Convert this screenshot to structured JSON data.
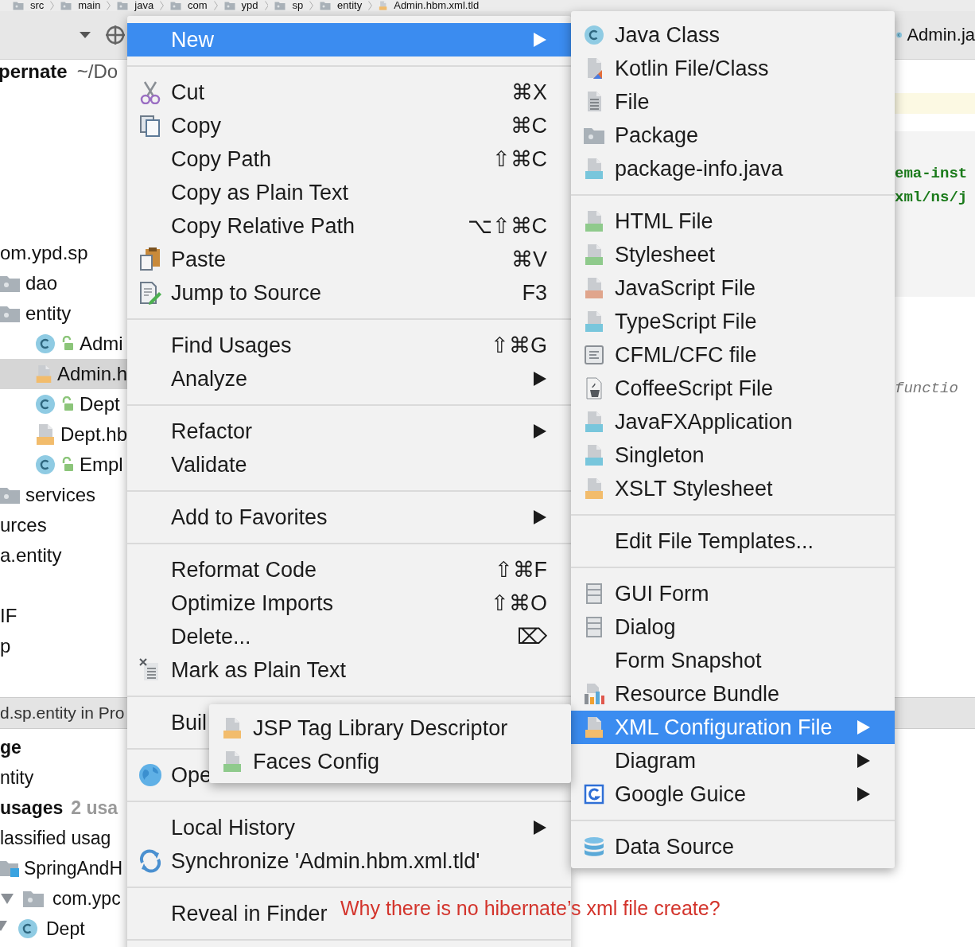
{
  "breadcrumb": [
    "src",
    "main",
    "java",
    "com",
    "ypd",
    "sp",
    "entity",
    "Admin.hbm.xml.tld"
  ],
  "toolbar": {
    "tab": "Admin.ja"
  },
  "project_tree": {
    "root": {
      "name": "pernate",
      "path": "~/Do"
    },
    "items": [
      {
        "label": "om.ypd.sp",
        "selected": false,
        "children": [
          {
            "label": "dao",
            "kind": "package",
            "selected": false
          },
          {
            "label": "entity",
            "kind": "package",
            "selected": false,
            "children": [
              {
                "label": "Admi",
                "kind": "class",
                "selected": false
              },
              {
                "label": "Admin.h",
                "kind": "xml",
                "selected": true
              },
              {
                "label": "Dept",
                "kind": "class",
                "selected": false
              },
              {
                "label": "Dept.hb",
                "kind": "xml",
                "selected": false
              },
              {
                "label": "Empl",
                "kind": "class",
                "selected": false
              }
            ]
          },
          {
            "label": "services",
            "kind": "package",
            "selected": false
          }
        ]
      },
      {
        "label": "urces",
        "selected": false
      },
      {
        "label": "a.entity",
        "selected": false
      },
      {
        "label": "IF",
        "selected": false
      },
      {
        "label": "p",
        "selected": false
      }
    ]
  },
  "usages_panel": {
    "title": "d.sp.entity in Pro",
    "rows": [
      {
        "label": "ge",
        "kind": "heading"
      },
      {
        "label": "ntity",
        "kind": "text"
      },
      {
        "label": "usages",
        "kind": "group",
        "count": "2 usa"
      },
      {
        "label": "lassified usag",
        "kind": "text",
        "children": [
          {
            "label": "SpringAndH",
            "kind": "module",
            "children": [
              {
                "label": "com.ypc",
                "kind": "package",
                "expanded": true,
                "children": [
                  {
                    "label": "Dept",
                    "kind": "class",
                    "expanded": true
                  }
                ]
              }
            ]
          }
        ]
      }
    ]
  },
  "editor": {
    "lines": [
      {
        "kind": "string",
        "text": "ema-inst"
      },
      {
        "kind": "string",
        "text": "xml/ns/j"
      },
      {
        "kind": "comment",
        "text": "functio"
      }
    ]
  },
  "context_menu": {
    "items": [
      {
        "kind": "item",
        "label": "New",
        "submenu": true,
        "selected": true
      },
      {
        "kind": "separator"
      },
      {
        "kind": "item",
        "label": "Cut",
        "shortcut": "⌘X",
        "selected": false
      },
      {
        "kind": "item",
        "label": "Copy",
        "shortcut": "⌘C",
        "selected": false
      },
      {
        "kind": "item",
        "label": "Copy Path",
        "shortcut": "⇧⌘C",
        "selected": false
      },
      {
        "kind": "item",
        "label": "Copy as Plain Text",
        "selected": false
      },
      {
        "kind": "item",
        "label": "Copy Relative Path",
        "shortcut": "⌥⇧⌘C",
        "selected": false
      },
      {
        "kind": "item",
        "label": "Paste",
        "shortcut": "⌘V",
        "selected": false
      },
      {
        "kind": "item",
        "label": "Jump to Source",
        "shortcut": "F3",
        "selected": false
      },
      {
        "kind": "separator"
      },
      {
        "kind": "item",
        "label": "Find Usages",
        "shortcut": "⇧⌘G",
        "selected": false
      },
      {
        "kind": "item",
        "label": "Analyze",
        "submenu": true,
        "selected": false
      },
      {
        "kind": "separator"
      },
      {
        "kind": "item",
        "label": "Refactor",
        "submenu": true,
        "selected": false
      },
      {
        "kind": "item",
        "label": "Validate",
        "selected": false
      },
      {
        "kind": "separator"
      },
      {
        "kind": "item",
        "label": "Add to Favorites",
        "submenu": true,
        "selected": false
      },
      {
        "kind": "separator"
      },
      {
        "kind": "item",
        "label": "Reformat Code",
        "shortcut": "⇧⌘F",
        "selected": false
      },
      {
        "kind": "item",
        "label": "Optimize Imports",
        "shortcut": "⇧⌘O",
        "selected": false
      },
      {
        "kind": "item",
        "label": "Delete...",
        "shortcut": "⌦",
        "selected": false
      },
      {
        "kind": "item",
        "label": "Mark as Plain Text",
        "selected": false
      },
      {
        "kind": "separator"
      },
      {
        "kind": "item",
        "label": "Buil",
        "selected": false
      },
      {
        "kind": "separator"
      },
      {
        "kind": "item",
        "label": "Ope",
        "selected": false
      },
      {
        "kind": "separator"
      },
      {
        "kind": "item",
        "label": "Local History",
        "submenu": true,
        "selected": false
      },
      {
        "kind": "item",
        "label": "Synchronize 'Admin.hbm.xml.tld'",
        "selected": false
      },
      {
        "kind": "separator"
      },
      {
        "kind": "item",
        "label": "Reveal in Finder",
        "selected": false
      },
      {
        "kind": "separator"
      }
    ]
  },
  "new_submenu": {
    "items": [
      {
        "kind": "item",
        "label": "Java Class",
        "selected": false
      },
      {
        "kind": "item",
        "label": "Kotlin File/Class",
        "selected": false
      },
      {
        "kind": "item",
        "label": "File",
        "selected": false
      },
      {
        "kind": "item",
        "label": "Package",
        "selected": false
      },
      {
        "kind": "item",
        "label": "package-info.java",
        "selected": false
      },
      {
        "kind": "separator"
      },
      {
        "kind": "item",
        "label": "HTML File",
        "selected": false
      },
      {
        "kind": "item",
        "label": "Stylesheet",
        "selected": false
      },
      {
        "kind": "item",
        "label": "JavaScript File",
        "selected": false
      },
      {
        "kind": "item",
        "label": "TypeScript File",
        "selected": false
      },
      {
        "kind": "item",
        "label": "CFML/CFC file",
        "selected": false
      },
      {
        "kind": "item",
        "label": "CoffeeScript File",
        "selected": false
      },
      {
        "kind": "item",
        "label": "JavaFXApplication",
        "selected": false
      },
      {
        "kind": "item",
        "label": "Singleton",
        "selected": false
      },
      {
        "kind": "item",
        "label": "XSLT Stylesheet",
        "selected": false
      },
      {
        "kind": "separator"
      },
      {
        "kind": "item",
        "label": "Edit File Templates...",
        "selected": false
      },
      {
        "kind": "separator"
      },
      {
        "kind": "item",
        "label": "GUI Form",
        "selected": false
      },
      {
        "kind": "item",
        "label": "Dialog",
        "selected": false
      },
      {
        "kind": "item",
        "label": "Form Snapshot",
        "selected": false
      },
      {
        "kind": "item",
        "label": "Resource Bundle",
        "selected": false
      },
      {
        "kind": "item",
        "label": "XML Configuration File",
        "submenu": true,
        "selected": true
      },
      {
        "kind": "item",
        "label": "Diagram",
        "submenu": true,
        "selected": false
      },
      {
        "kind": "item",
        "label": "Google Guice",
        "submenu": true,
        "selected": false
      },
      {
        "kind": "separator"
      },
      {
        "kind": "item",
        "label": "Data Source",
        "selected": false
      }
    ]
  },
  "xml_submenu": {
    "items": [
      {
        "kind": "item",
        "label": "JSP Tag Library Descriptor",
        "selected": false
      },
      {
        "kind": "item",
        "label": "Faces Config",
        "selected": false
      }
    ]
  },
  "annotation": "Why there is no hibernate’s xml file create?"
}
